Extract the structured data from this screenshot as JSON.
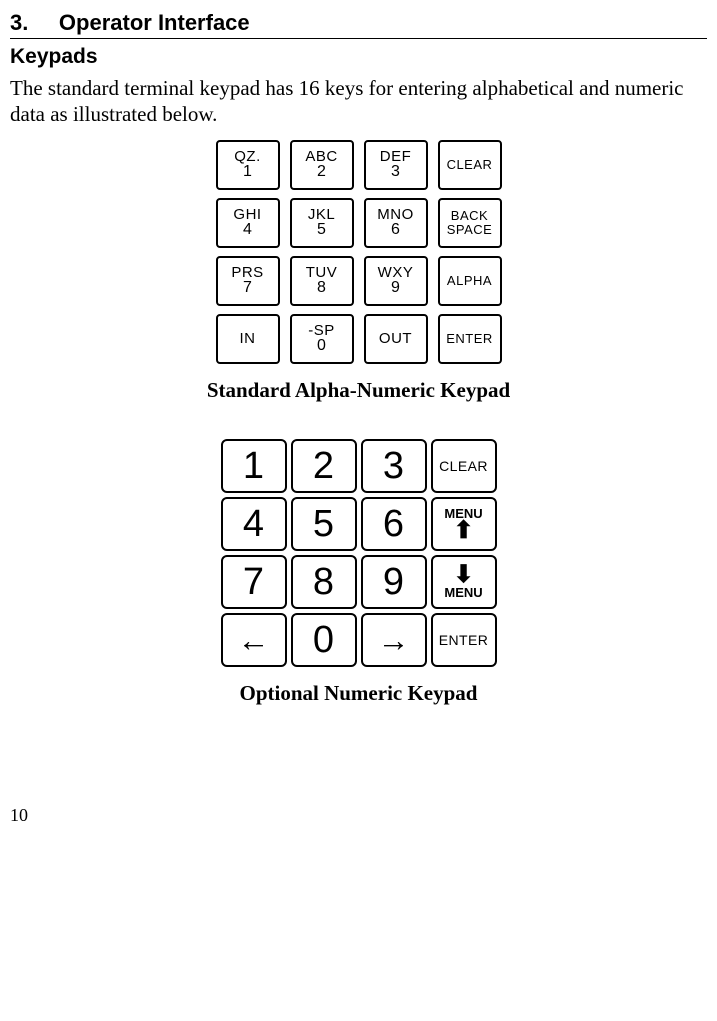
{
  "section": {
    "num": "3.",
    "title": "Operator Interface"
  },
  "subhead": "Keypads",
  "intro": "The standard terminal keypad has 16 keys for entering alphabetical and numeric data as illustrated below.",
  "alpha": {
    "r1c1_l1": "QZ.",
    "r1c1_l2": "1",
    "r1c2_l1": "ABC",
    "r1c2_l2": "2",
    "r1c3_l1": "DEF",
    "r1c3_l2": "3",
    "r1c4": "CLEAR",
    "r2c1_l1": "GHI",
    "r2c1_l2": "4",
    "r2c2_l1": "JKL",
    "r2c2_l2": "5",
    "r2c3_l1": "MNO",
    "r2c3_l2": "6",
    "r2c4_l1": "BACK",
    "r2c4_l2": "SPACE",
    "r3c1_l1": "PRS",
    "r3c1_l2": "7",
    "r3c2_l1": "TUV",
    "r3c2_l2": "8",
    "r3c3_l1": "WXY",
    "r3c3_l2": "9",
    "r3c4": "ALPHA",
    "r4c1": "IN",
    "r4c2_l1": "-SP",
    "r4c2_l2": "0",
    "r4c3": "OUT",
    "r4c4": "ENTER"
  },
  "caption_alpha": "Standard Alpha-Numeric Keypad",
  "num": {
    "k1": "1",
    "k2": "2",
    "k3": "3",
    "clear": "CLEAR",
    "k4": "4",
    "k5": "5",
    "k6": "6",
    "menu_up": "MENU",
    "k7": "7",
    "k8": "8",
    "k9": "9",
    "menu_down": "MENU",
    "left": "←",
    "k0": "0",
    "right": "→",
    "enter": "ENTER",
    "arrow_up": "⬆",
    "arrow_down": "⬇"
  },
  "caption_num": "Optional Numeric Keypad",
  "page": "10"
}
